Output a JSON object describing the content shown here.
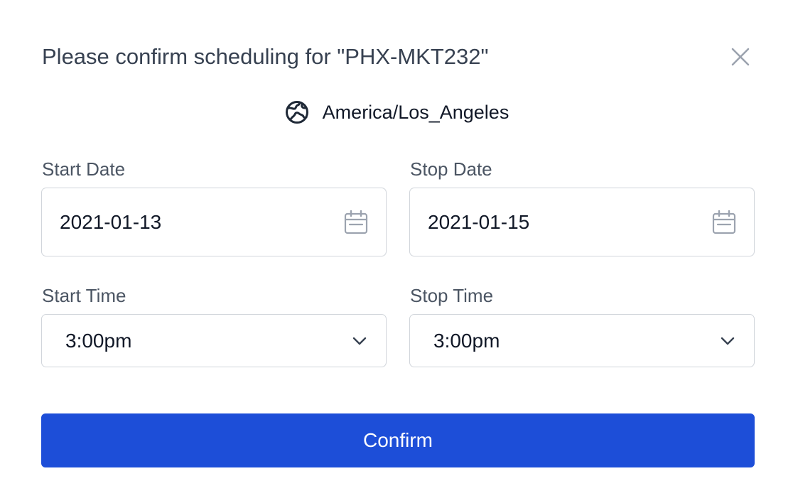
{
  "dialog": {
    "title": "Please confirm scheduling for \"PHX-MKT232\"",
    "close_icon": "close-icon"
  },
  "timezone": {
    "icon": "globe-icon",
    "label": "America/Los_Angeles"
  },
  "start_date": {
    "label": "Start Date",
    "value": "2021-01-13",
    "icon": "calendar-icon"
  },
  "stop_date": {
    "label": "Stop Date",
    "value": "2021-01-15",
    "icon": "calendar-icon"
  },
  "start_time": {
    "label": "Start Time",
    "value": "3:00pm",
    "icon": "chevron-down-icon"
  },
  "stop_time": {
    "label": "Stop Time",
    "value": "3:00pm",
    "icon": "chevron-down-icon"
  },
  "confirm_button": {
    "label": "Confirm"
  },
  "colors": {
    "primary": "#1d4ed8",
    "border": "#d1d5db",
    "label": "#4b5563",
    "text": "#111827"
  }
}
